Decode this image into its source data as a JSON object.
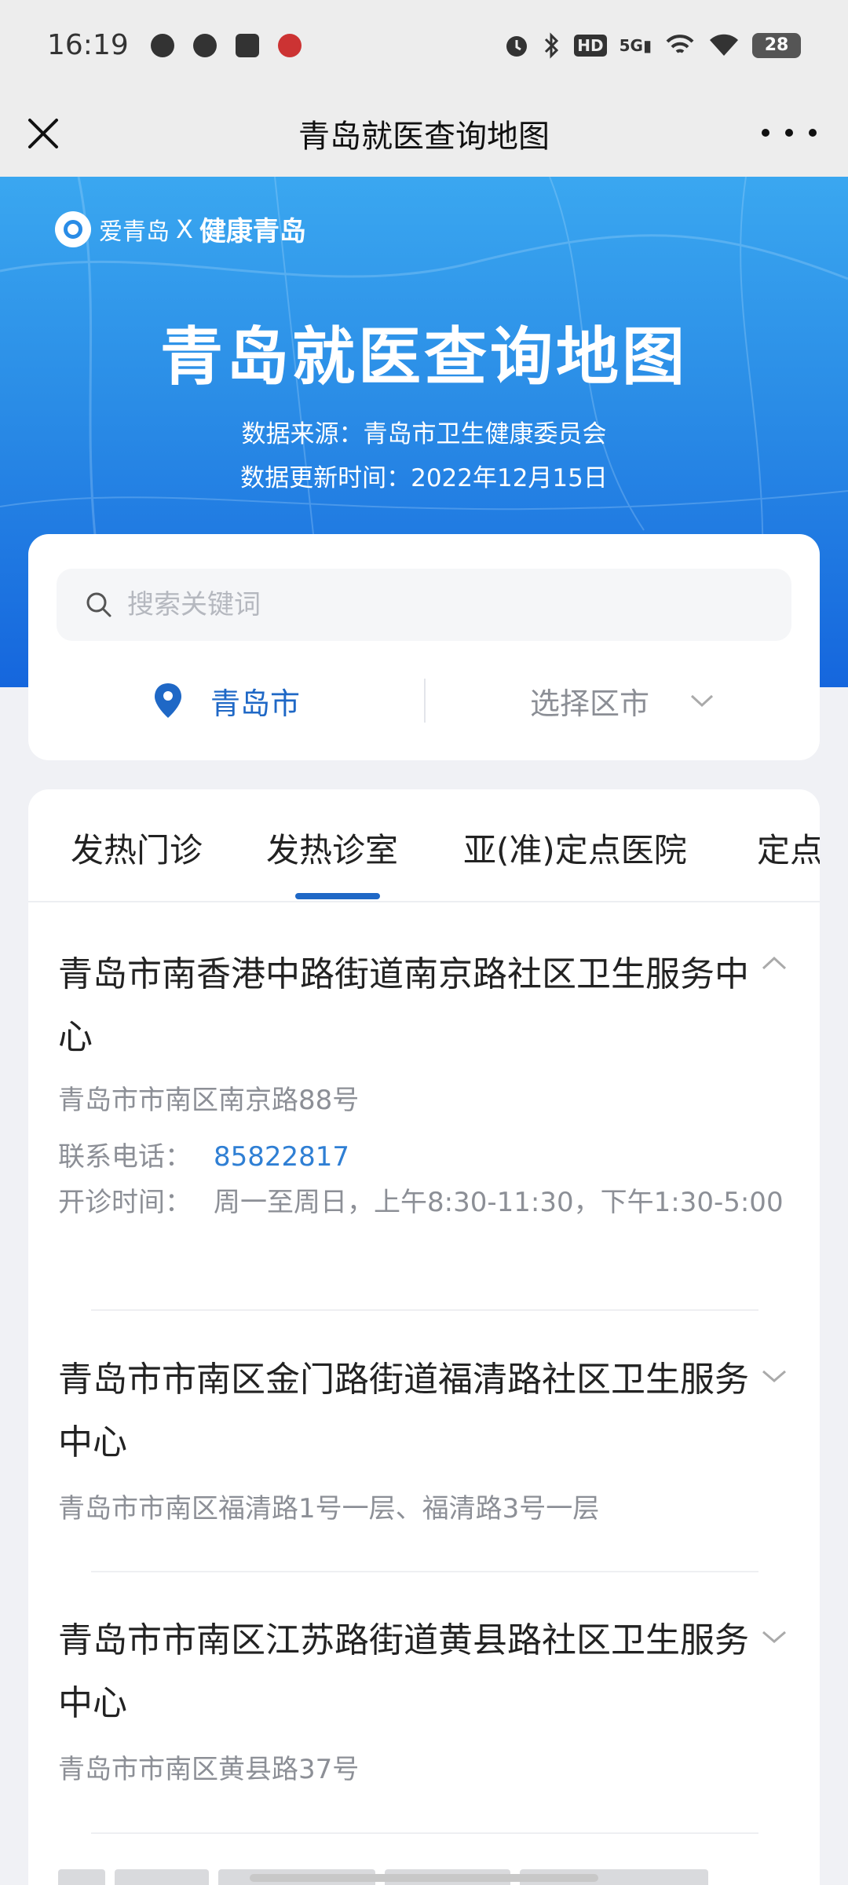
{
  "status_bar": {
    "time": "16:19",
    "left_icons": [
      "sf-express-icon",
      "chat-bubble-icon",
      "mail-icon",
      "app-icon"
    ],
    "right_icons": [
      "alarm-icon",
      "bluetooth-icon",
      "hd-icon",
      "signal-5g-icon",
      "wifi-calling-icon",
      "wifi-icon"
    ],
    "hd_label": "HD",
    "net_label": "5G",
    "battery": "28"
  },
  "title_bar": {
    "title": "青岛就医查询地图",
    "close_icon": "close-icon",
    "more_icon": "more-dots-icon"
  },
  "banner": {
    "brand_a": "爱青岛",
    "brand_x": "X",
    "brand_b": "健康青岛",
    "title": "青岛就医查询地图",
    "source": "数据来源：青岛市卫生健康委员会",
    "updated": "数据更新时间：2022年12月15日",
    "colors": {
      "top": "#3aa7f0",
      "bottom": "#1566dd"
    }
  },
  "search": {
    "placeholder": "搜索关键词",
    "value": "",
    "icon": "search-icon"
  },
  "location": {
    "city": "青岛市",
    "district_placeholder": "选择区市",
    "pin_icon": "location-pin-icon",
    "accent": "#1f68c6"
  },
  "tabs": [
    {
      "label": "发热门诊",
      "active": false
    },
    {
      "label": "发热诊室",
      "active": true
    },
    {
      "label": "亚(准)定点医院",
      "active": false
    },
    {
      "label": "定点",
      "active": false
    }
  ],
  "items": [
    {
      "name": "青岛市南香港中路街道南京路社区卫生服务中心",
      "address": "青岛市市南区南京路88号",
      "phone_label": "联系电话：",
      "phone": "85822817",
      "hours_label": "开诊时间：",
      "hours": "周一至周日，上午8:30-11:30，下午1:30-5:00",
      "expanded": true
    },
    {
      "name": "青岛市市南区金门路街道福清路社区卫生服务中心",
      "address": "青岛市市南区福清路1号一层、福清路3号一层",
      "expanded": false
    },
    {
      "name": "青岛市市南区江苏路街道黄县路社区卫生服务中心",
      "address": "青岛市市南区黄县路37号",
      "expanded": false
    }
  ]
}
